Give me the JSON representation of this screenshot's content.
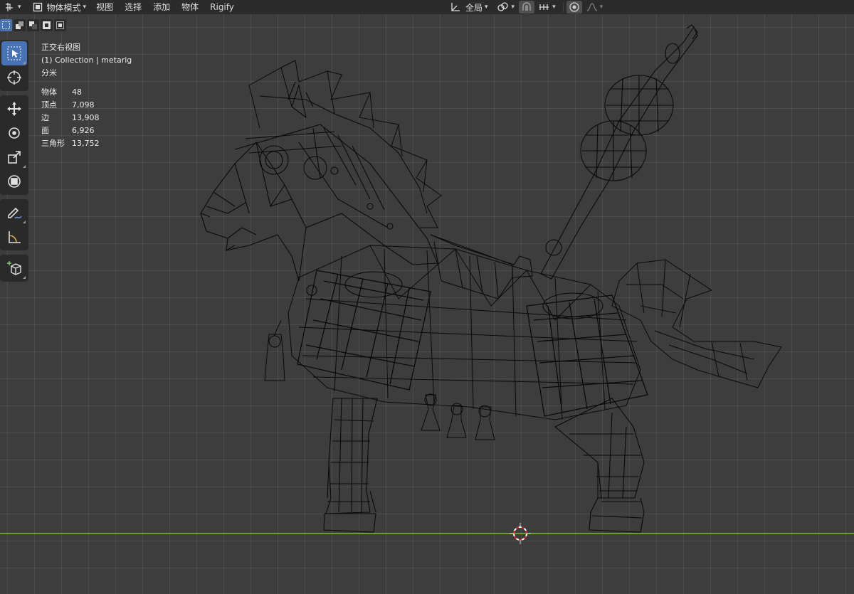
{
  "header": {
    "editor_type_icon": "3d-viewport-icon",
    "mode": {
      "icon": "object-mode-icon",
      "label": "物体模式"
    },
    "menus": [
      "视图",
      "选择",
      "添加",
      "物体",
      "Rigify"
    ],
    "transform_orientation": {
      "icon": "orientation-icon",
      "label": "全局"
    }
  },
  "overlay": {
    "view_name": "正交右视图",
    "collection": "(1) Collection | metarig",
    "units": "分米"
  },
  "stats": [
    {
      "key": "物体",
      "value": "48"
    },
    {
      "key": "顶点",
      "value": "7,098"
    },
    {
      "key": "边",
      "value": "13,908"
    },
    {
      "key": "面",
      "value": "6,926"
    },
    {
      "key": "三角形",
      "value": "13,752"
    }
  ],
  "toolbar": [
    "select-box-icon",
    "cursor-icon",
    "move-icon",
    "rotate-icon",
    "scale-icon",
    "transform-icon",
    "annotate-icon",
    "measure-icon",
    "add-cube-icon"
  ],
  "colors": {
    "accent": "#4772b3",
    "x_axis": "#6b9a2e",
    "wire": "#000000",
    "background": "#3d3d3d"
  }
}
